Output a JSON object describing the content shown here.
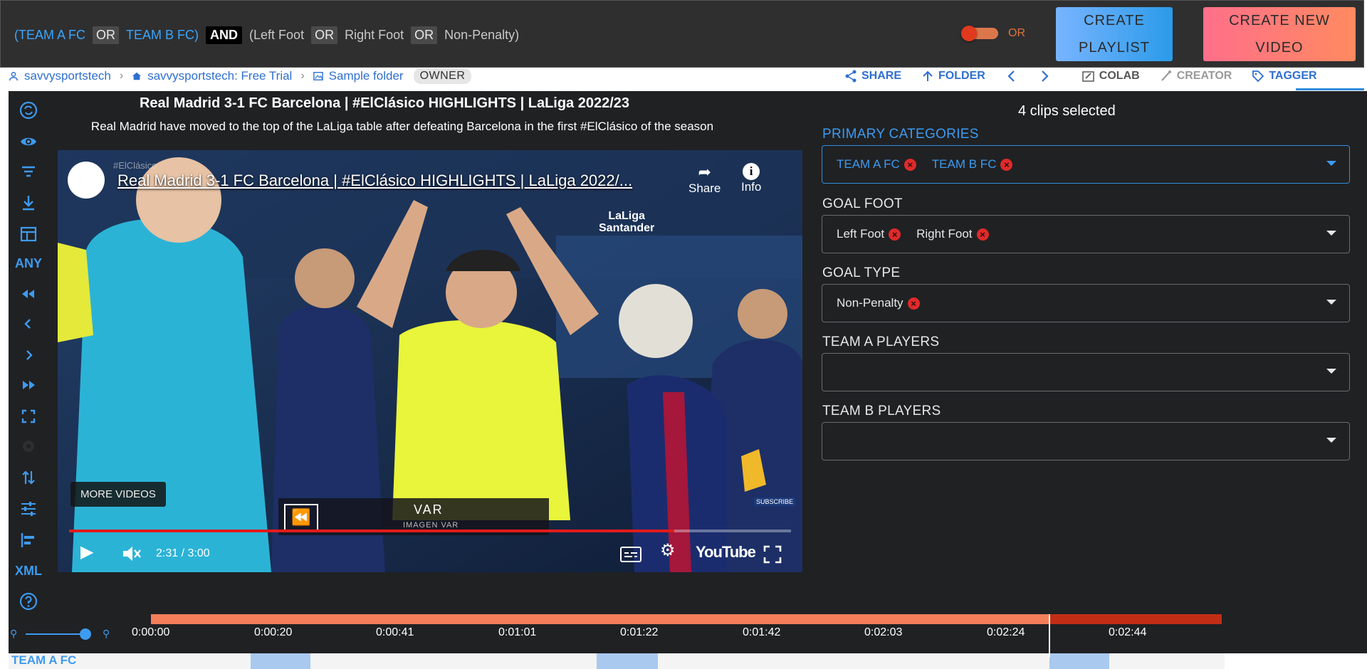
{
  "filter": {
    "open_paren": "(",
    "team_a": "TEAM A FC",
    "or1": "OR",
    "team_b": "TEAM B FC)",
    "and": "AND",
    "left_foot": "(Left Foot",
    "or2": "OR",
    "right_foot": "Right Foot",
    "or3": "OR",
    "non_penalty": "Non-Penalty)",
    "toggle_label": "OR"
  },
  "buttons": {
    "create_playlist": [
      "CREATE",
      "PLAYLIST"
    ],
    "create_new_video": [
      "CREATE NEW",
      "VIDEO"
    ]
  },
  "breadcrumb": {
    "user": "savvysportstech",
    "workspace": "savvysportstech: Free Trial",
    "folder": "Sample folder",
    "role": "OWNER"
  },
  "actions": {
    "share": "SHARE",
    "folder": "FOLDER",
    "colab": "COLAB",
    "creator": "CREATOR",
    "tagger": "TAGGER"
  },
  "sidebar": {
    "any_label": "ANY",
    "xml_label": "XML"
  },
  "video": {
    "title": "Real Madrid 3-1 FC Barcelona | #ElClásico HIGHLIGHTS | LaLiga 2022/23",
    "subtitle": "Real Madrid have moved to the top of the LaLiga table after defeating Barcelona in the first #ElClásico of the season",
    "embed_title": "Real Madrid 3-1 FC Barcelona | #ElClásico HIGHLIGHTS | LaLiga 2022/...",
    "hashtag": "#ElClásico",
    "share_label": "Share",
    "info_label": "Info",
    "brand_line1": "LaLiga",
    "brand_line2": "Santander",
    "more_videos": "MORE VIDEOS",
    "overlay_title": "VAR",
    "overlay_sub": "IMAGEN VAR",
    "subscribe": "SUBSCRIBE",
    "time": "2:31 / 3:00",
    "progress_fraction": 0.8378,
    "youtube_label": "YouTube"
  },
  "tagger": {
    "clips_selected": "4 clips selected",
    "fields": [
      {
        "label": "PRIMARY CATEGORIES",
        "chips": [
          "TEAM A FC",
          "TEAM B FC"
        ]
      },
      {
        "label": "GOAL FOOT",
        "chips": [
          "Left Foot",
          "Right Foot"
        ]
      },
      {
        "label": "GOAL TYPE",
        "chips": [
          "Non-Penalty"
        ]
      },
      {
        "label": "TEAM A PLAYERS",
        "chips": []
      },
      {
        "label": "TEAM B PLAYERS",
        "chips": []
      }
    ]
  },
  "timeline": {
    "ticks": [
      "0:00:00",
      "0:00:20",
      "0:00:41",
      "0:01:01",
      "0:01:22",
      "0:01:42",
      "0:02:03",
      "0:02:24",
      "0:02:44"
    ],
    "track_label": "TEAM A FC"
  },
  "colors": {
    "accent_blue": "#3d9bf0",
    "chip_remove_red": "#e02a2a",
    "timeline_orange": "#f47e5a",
    "timeline_red": "#c22d16"
  }
}
